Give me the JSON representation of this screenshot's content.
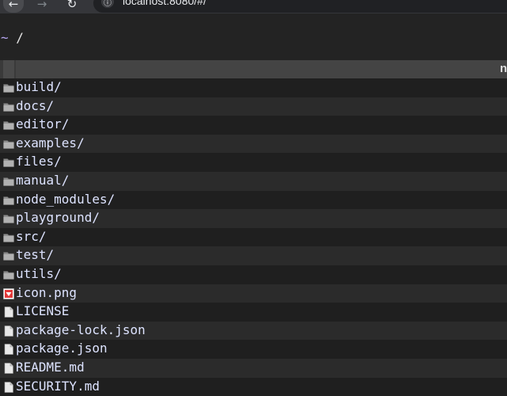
{
  "browser": {
    "back": "←",
    "forward": "→",
    "reload": "↻",
    "url": "localhost:8080/#/"
  },
  "listing": {
    "path_prefix": "~",
    "path": " /",
    "header_name": "n",
    "items": [
      {
        "name": "build/",
        "type": "folder"
      },
      {
        "name": "docs/",
        "type": "folder"
      },
      {
        "name": "editor/",
        "type": "folder"
      },
      {
        "name": "examples/",
        "type": "folder"
      },
      {
        "name": "files/",
        "type": "folder"
      },
      {
        "name": "manual/",
        "type": "folder"
      },
      {
        "name": "node_modules/",
        "type": "folder"
      },
      {
        "name": "playground/",
        "type": "folder"
      },
      {
        "name": "src/",
        "type": "folder"
      },
      {
        "name": "test/",
        "type": "folder"
      },
      {
        "name": "utils/",
        "type": "folder"
      },
      {
        "name": "icon.png",
        "type": "image"
      },
      {
        "name": "LICENSE",
        "type": "file"
      },
      {
        "name": "package-lock.json",
        "type": "file"
      },
      {
        "name": "package.json",
        "type": "file"
      },
      {
        "name": "README.md",
        "type": "file"
      },
      {
        "name": "SECURITY.md",
        "type": "file"
      }
    ]
  },
  "colors": {
    "link": "#dde3ff",
    "tilde": "#b7a6f2",
    "row_odd": "#1f1f1f",
    "row_even": "#2b2b2b"
  }
}
